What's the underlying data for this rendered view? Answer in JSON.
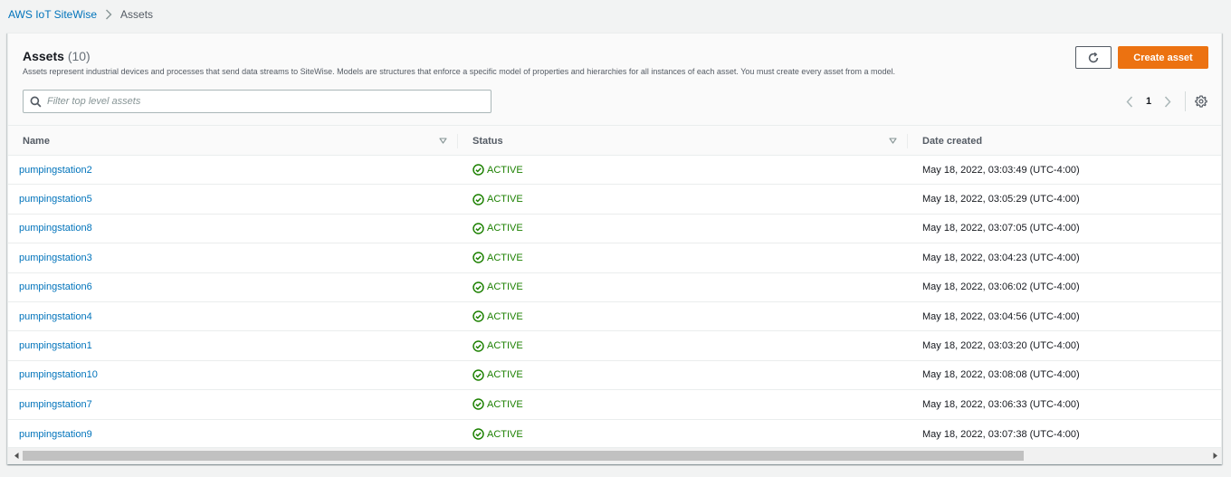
{
  "breadcrumb": {
    "service": "AWS IoT SiteWise",
    "current": "Assets"
  },
  "header": {
    "title": "Assets",
    "count": "(10)",
    "description": "Assets represent industrial devices and processes that send data streams to SiteWise. Models are structures that enforce a specific model of properties and hierarchies for all instances of each asset. You must create every asset from a model.",
    "refresh_icon": "refresh-icon",
    "create_label": "Create asset"
  },
  "search": {
    "placeholder": "Filter top level assets",
    "value": ""
  },
  "pager": {
    "current_page": "1"
  },
  "columns": {
    "name": "Name",
    "status": "Status",
    "date": "Date created"
  },
  "rows": [
    {
      "name": "pumpingstation2",
      "status": "ACTIVE",
      "date": "May 18, 2022, 03:03:49 (UTC-4:00)"
    },
    {
      "name": "pumpingstation5",
      "status": "ACTIVE",
      "date": "May 18, 2022, 03:05:29 (UTC-4:00)"
    },
    {
      "name": "pumpingstation8",
      "status": "ACTIVE",
      "date": "May 18, 2022, 03:07:05 (UTC-4:00)"
    },
    {
      "name": "pumpingstation3",
      "status": "ACTIVE",
      "date": "May 18, 2022, 03:04:23 (UTC-4:00)"
    },
    {
      "name": "pumpingstation6",
      "status": "ACTIVE",
      "date": "May 18, 2022, 03:06:02 (UTC-4:00)"
    },
    {
      "name": "pumpingstation4",
      "status": "ACTIVE",
      "date": "May 18, 2022, 03:04:56 (UTC-4:00)"
    },
    {
      "name": "pumpingstation1",
      "status": "ACTIVE",
      "date": "May 18, 2022, 03:03:20 (UTC-4:00)"
    },
    {
      "name": "pumpingstation10",
      "status": "ACTIVE",
      "date": "May 18, 2022, 03:08:08 (UTC-4:00)"
    },
    {
      "name": "pumpingstation7",
      "status": "ACTIVE",
      "date": "May 18, 2022, 03:06:33 (UTC-4:00)"
    },
    {
      "name": "pumpingstation9",
      "status": "ACTIVE",
      "date": "May 18, 2022, 03:07:38 (UTC-4:00)"
    }
  ],
  "colors": {
    "link": "#0073bb",
    "primary_button": "#ec7211",
    "status_ok": "#1d8102"
  }
}
